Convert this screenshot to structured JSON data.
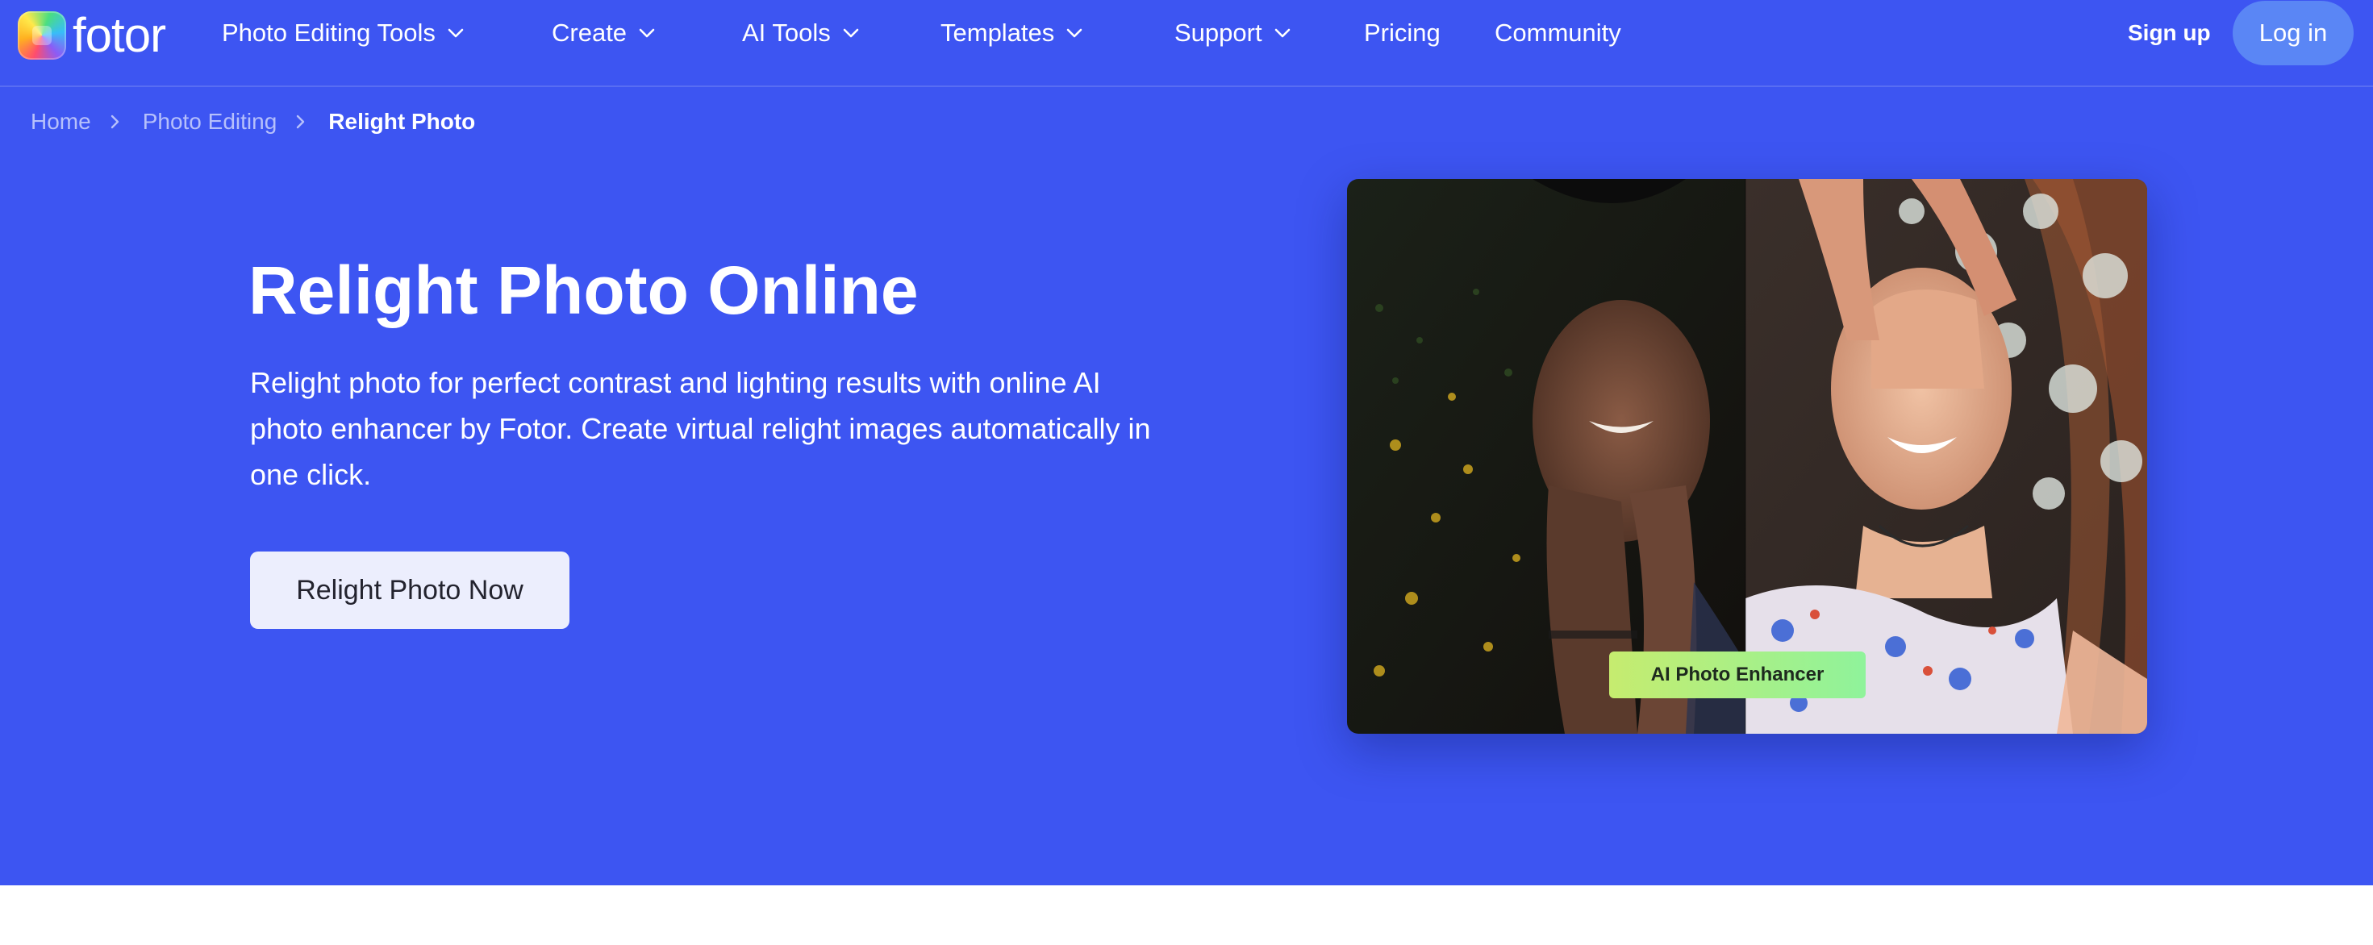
{
  "brand": {
    "name": "fotor"
  },
  "nav": {
    "items": [
      {
        "label": "Photo Editing Tools",
        "dropdown": true
      },
      {
        "label": "Create",
        "dropdown": true
      },
      {
        "label": "AI Tools",
        "dropdown": true
      },
      {
        "label": "Templates",
        "dropdown": true
      },
      {
        "label": "Support",
        "dropdown": true
      },
      {
        "label": "Pricing",
        "dropdown": false
      },
      {
        "label": "Community",
        "dropdown": false
      }
    ],
    "signup_label": "Sign up",
    "login_label": "Log in"
  },
  "breadcrumb": {
    "items": [
      "Home",
      "Photo Editing"
    ],
    "current": "Relight Photo"
  },
  "hero": {
    "title": "Relight Photo Online",
    "description": "Relight photo for perfect contrast and lighting results with online AI photo enhancer by Fotor. Create virtual relight images automatically in one click.",
    "cta_label": "Relight Photo Now",
    "image_badge": "AI Photo Enhancer"
  },
  "colors": {
    "hero_background": "#3d55f2",
    "login_button": "#5a86f5",
    "cta_button": "#eceefd",
    "badge_gradient_start": "#c6ec6f",
    "badge_gradient_end": "#8ff39b"
  }
}
